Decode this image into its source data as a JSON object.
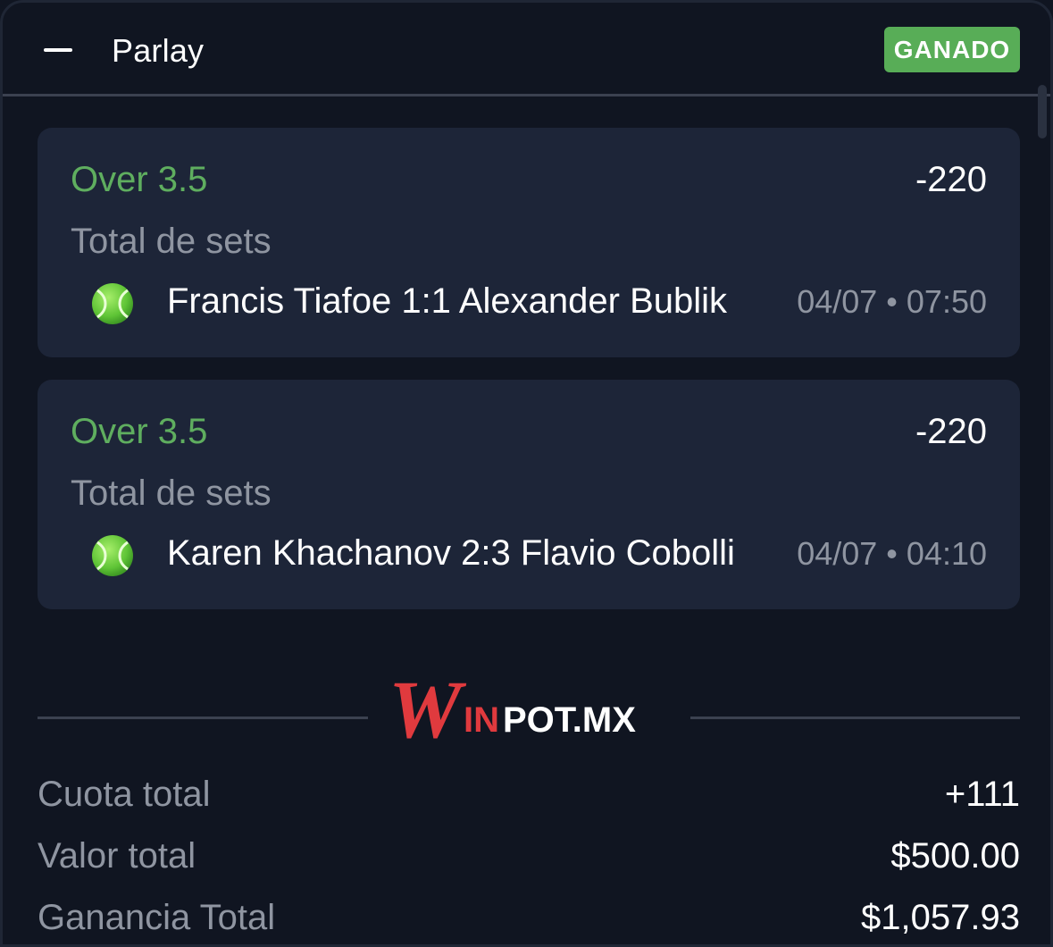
{
  "header": {
    "title": "Parlay",
    "status": "GANADO",
    "status_color": "#58ad57"
  },
  "bets": [
    {
      "pick": "Over 3.5",
      "odds": "-220",
      "market": "Total de sets",
      "sport_icon": "tennis-ball-icon",
      "match": "Francis Tiafoe 1:1 Alexander Bublik",
      "datetime": "04/07 • 07:50"
    },
    {
      "pick": "Over 3.5",
      "odds": "-220",
      "market": "Total de sets",
      "sport_icon": "tennis-ball-icon",
      "match": "Karen Khachanov 2:3 Flavio Cobolli",
      "datetime": "04/07 • 04:10"
    }
  ],
  "brand": {
    "logo_text_w": "W",
    "logo_text_in": "IN",
    "logo_text_rest": "POT.MX",
    "accent": "#e03a3e"
  },
  "summary": {
    "cuota_label": "Cuota total",
    "cuota_value": "+111",
    "valor_label": "Valor total",
    "valor_value": "$500.00",
    "ganancia_label": "Ganancia Total",
    "ganancia_value": "$1,057.93"
  },
  "colors": {
    "background": "#101521",
    "card": "#1d2538",
    "pick_green": "#5fae5f",
    "muted": "#8f95a1"
  }
}
